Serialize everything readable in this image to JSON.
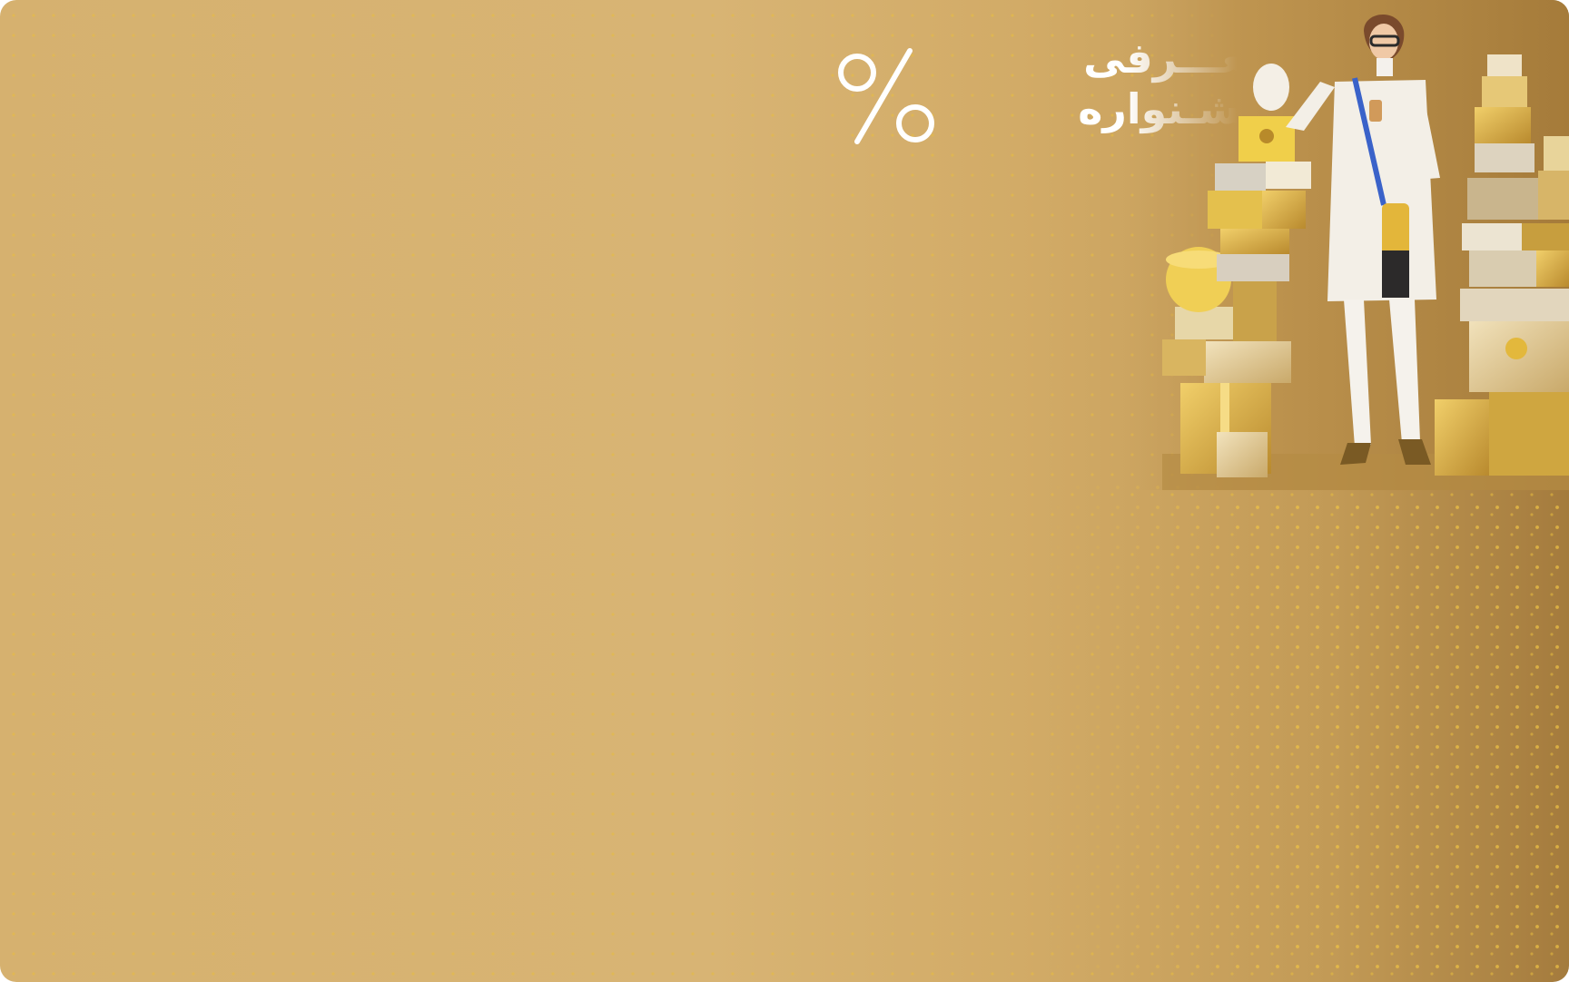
{
  "banner": {
    "headline_line1": "معـــرفی",
    "headline_line2": "جشـنواره",
    "percent_icon": "percent-icon",
    "photo_subject": "woman-with-gift-boxes"
  },
  "colors": {
    "background": "#d6b16f",
    "background_dark_edge": "#a47b3d",
    "pattern": "#e8be3e",
    "headline_text": "#ffffff"
  }
}
